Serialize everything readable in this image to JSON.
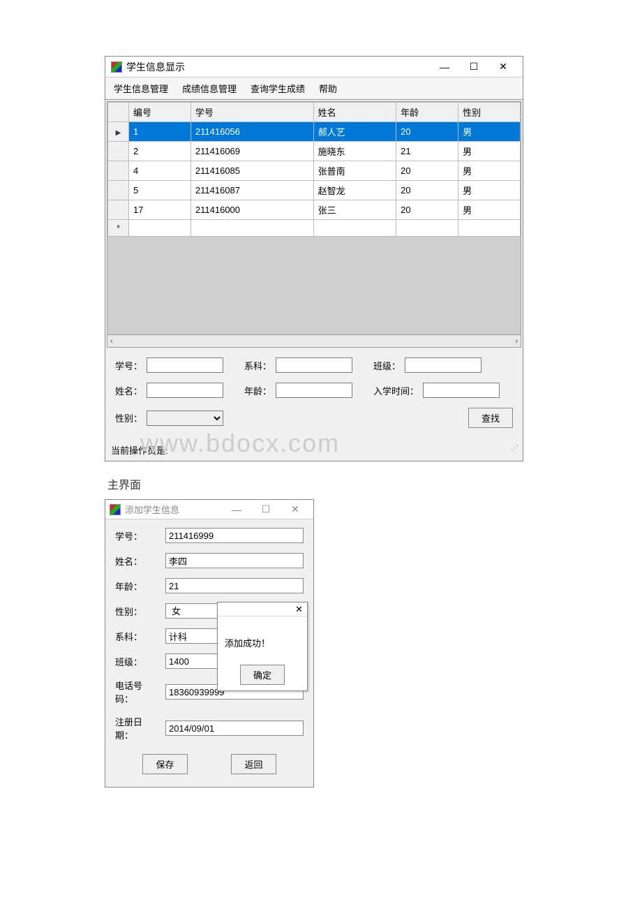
{
  "window1": {
    "title": "学生信息显示",
    "menu": [
      "学生信息管理",
      "成绩信息管理",
      "查询学生成绩",
      "帮助"
    ],
    "columns": [
      "编号",
      "学号",
      "姓名",
      "年龄",
      "性别"
    ],
    "rows": [
      {
        "id": "1",
        "sno": "211416056",
        "name": "郝人艺",
        "age": "20",
        "sex": "男",
        "selected": true
      },
      {
        "id": "2",
        "sno": "211416069",
        "name": "施晓东",
        "age": "21",
        "sex": "男"
      },
      {
        "id": "4",
        "sno": "211416085",
        "name": "张普南",
        "age": "20",
        "sex": "男"
      },
      {
        "id": "5",
        "sno": "211416087",
        "name": "赵智龙",
        "age": "20",
        "sex": "男"
      },
      {
        "id": "17",
        "sno": "211416000",
        "name": "张三",
        "age": "20",
        "sex": "男"
      }
    ],
    "filters": {
      "sno_label": "学号：",
      "dept_label": "系科：",
      "class_label": "班级：",
      "name_label": "姓名：",
      "age_label": "年龄：",
      "enroll_label": "入学时间：",
      "sex_label": "性别：",
      "search_btn": "查找"
    },
    "status_prefix": "当前操作员是:",
    "watermark": "www.bdocx.com"
  },
  "caption": "主界面",
  "window2": {
    "title": "添加学生信息",
    "labels": {
      "sno": "学号：",
      "name": "姓名：",
      "age": "年龄：",
      "sex": "性别：",
      "dept": "系科：",
      "class": "班级：",
      "phone": "电话号码：",
      "regdate": "注册日期："
    },
    "values": {
      "sno": "211416999",
      "name": "李四",
      "age": "21",
      "sex": "女",
      "dept": "计科",
      "class": "1400",
      "phone": "18360939999",
      "regdate": "2014/09/01"
    },
    "save_btn": "保存",
    "back_btn": "返回"
  },
  "msgbox": {
    "text": "添加成功！",
    "ok": "确定"
  }
}
